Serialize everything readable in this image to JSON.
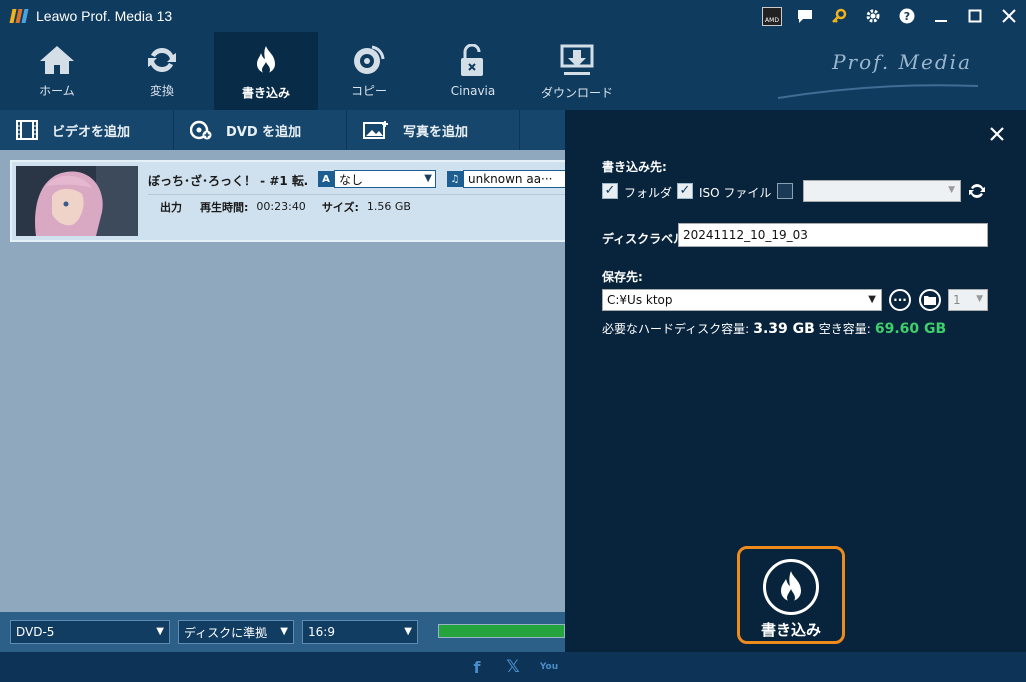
{
  "app": {
    "title": "Leawo Prof. Media 13",
    "brand": "Prof. Media"
  },
  "window": {
    "amd_badge": "AMD"
  },
  "nav": [
    {
      "id": "home",
      "label": "ホーム",
      "icon": "home-icon"
    },
    {
      "id": "convert",
      "label": "変換",
      "icon": "refresh-icon"
    },
    {
      "id": "burn",
      "label": "書き込み",
      "icon": "flame-icon",
      "active": true
    },
    {
      "id": "copy",
      "label": "コピー",
      "icon": "disc-icon"
    },
    {
      "id": "cinavia",
      "label": "Cinavia",
      "icon": "unlock-icon"
    },
    {
      "id": "download",
      "label": "ダウンロード",
      "icon": "download-icon"
    }
  ],
  "toolbar": {
    "add_video": "ビデオを追加",
    "add_dvd": "DVD を追加",
    "add_photo": "写真を追加"
  },
  "item": {
    "title": "ぼっち･ざ･ろっく！ - #1 転…",
    "subtitle_value": "なし",
    "audio_value": "unknown aa···",
    "output_label": "出力",
    "duration_label": "再生時間:",
    "duration_value": "00:23:40",
    "size_label": "サイズ:",
    "size_value": "1.56 GB"
  },
  "bottom": {
    "disc_type": "DVD-5",
    "quality": "ディスクに準拠",
    "aspect": "16:9",
    "progress_fraction": 1.0
  },
  "panel": {
    "dest_label": "書き込み先:",
    "folder_label": "フォルダ",
    "iso_label": "ISO ファイル",
    "folder_checked": true,
    "iso_checked": true,
    "drive_checked": false,
    "drive_value": "",
    "disc_label_label": "ディスクラベル:",
    "disc_label_value": "20241112_10_19_03",
    "save_to_label": "保存先:",
    "save_path": "C:¥Us            ktop",
    "copies_value": "1",
    "required_label": "必要なハードディスク容量:",
    "required_value": "3.39 GB",
    "free_label": "空き容量:",
    "free_value": "69.60 GB",
    "burn_label": "書き込み"
  },
  "footer": {
    "facebook": "f",
    "x": "𝕏",
    "youtube": "You"
  },
  "colors": {
    "accent": "#ef8a1d",
    "free_space": "#3fcf6a",
    "progress": "#25a33c"
  }
}
